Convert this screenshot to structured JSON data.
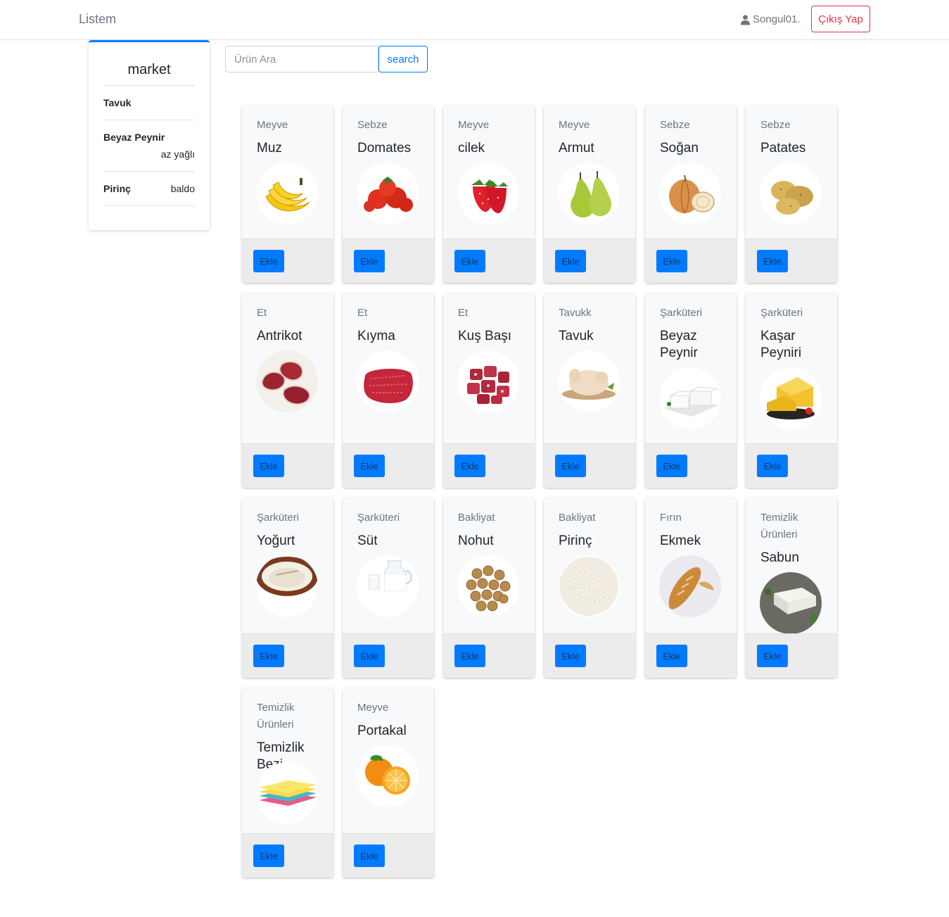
{
  "navbar": {
    "brand": "Listem",
    "username": "Songul01.",
    "logout_label": "Çıkış Yap"
  },
  "list": {
    "title": "market",
    "items": [
      {
        "name": "Tavuk",
        "note": ""
      },
      {
        "name": "Beyaz Peynir",
        "note": "az yağlı"
      },
      {
        "name": "Pirinç",
        "note": "baldo"
      }
    ]
  },
  "search": {
    "placeholder": "Ürün Ara",
    "button_label": "search"
  },
  "products": [
    {
      "category": "Meyve",
      "name": "Muz",
      "icon": "banana-icon",
      "add_label": "Ekle"
    },
    {
      "category": "Sebze",
      "name": "Domates",
      "icon": "tomato-icon",
      "add_label": "Ekle"
    },
    {
      "category": "Meyve",
      "name": "cilek",
      "icon": "strawberry-icon",
      "add_label": "Ekle"
    },
    {
      "category": "Meyve",
      "name": "Armut",
      "icon": "pear-icon",
      "add_label": "Ekle"
    },
    {
      "category": "Sebze",
      "name": "Soğan",
      "icon": "onion-icon",
      "add_label": "Ekle"
    },
    {
      "category": "Sebze",
      "name": "Patates",
      "icon": "potato-icon",
      "add_label": "Ekle"
    },
    {
      "category": "Et",
      "name": "Antrikot",
      "icon": "steak-icon",
      "add_label": "Ekle"
    },
    {
      "category": "Et",
      "name": "Kıyma",
      "icon": "ground-meat-icon",
      "add_label": "Ekle"
    },
    {
      "category": "Et",
      "name": "Kuş Başı",
      "icon": "diced-meat-icon",
      "add_label": "Ekle"
    },
    {
      "category": "Tavukk",
      "name": "Tavuk",
      "icon": "chicken-icon",
      "add_label": "Ekle"
    },
    {
      "category": "Şarküteri",
      "name": "Beyaz Peynir",
      "icon": "white-cheese-icon",
      "add_label": "Ekle"
    },
    {
      "category": "Şarküteri",
      "name": "Kaşar Peyniri",
      "icon": "cheddar-icon",
      "add_label": "Ekle"
    },
    {
      "category": "Şarküteri",
      "name": "Yoğurt",
      "icon": "yogurt-icon",
      "add_label": "Ekle"
    },
    {
      "category": "Şarküteri",
      "name": "Süt",
      "icon": "milk-icon",
      "add_label": "Ekle"
    },
    {
      "category": "Bakliyat",
      "name": "Nohut",
      "icon": "chickpea-icon",
      "add_label": "Ekle"
    },
    {
      "category": "Bakliyat",
      "name": "Pirinç",
      "icon": "rice-icon",
      "add_label": "Ekle"
    },
    {
      "category": "Fırın",
      "name": "Ekmek",
      "icon": "bread-icon",
      "add_label": "Ekle"
    },
    {
      "category": "Temizlik Ürünleri",
      "name": "Sabun",
      "icon": "soap-icon",
      "add_label": "Ekle"
    },
    {
      "category": "Temizlik Ürünleri",
      "name": "Temizlik Bezi",
      "icon": "cloth-icon",
      "add_label": "Ekle"
    },
    {
      "category": "Meyve",
      "name": "Portakal",
      "icon": "orange-icon",
      "add_label": "Ekle"
    }
  ],
  "colors": {
    "primary": "#007bff",
    "danger": "#dc3545",
    "muted": "#6c757d"
  }
}
